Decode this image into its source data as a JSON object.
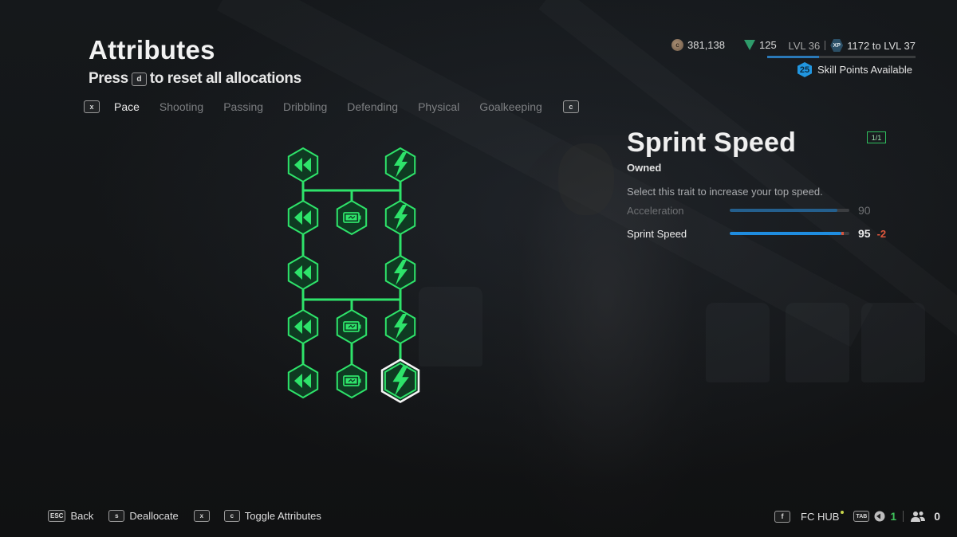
{
  "header": {
    "title": "Attributes",
    "subtitle_pre": "Press",
    "subtitle_key": "d",
    "subtitle_post": "to reset all allocations"
  },
  "tabs": {
    "prev_key": "x",
    "next_key": "c",
    "items": [
      {
        "label": "Pace",
        "active": true
      },
      {
        "label": "Shooting",
        "active": false
      },
      {
        "label": "Passing",
        "active": false
      },
      {
        "label": "Dribbling",
        "active": false
      },
      {
        "label": "Defending",
        "active": false
      },
      {
        "label": "Physical",
        "active": false
      },
      {
        "label": "Goalkeeping",
        "active": false
      }
    ]
  },
  "currency": {
    "coins": "381,138",
    "points": "125",
    "level": "LVL 36",
    "xp_icon_label": "XP",
    "xp_to_next": "1172 to LVL 37",
    "xp_progress_percent": 35,
    "skill_points": "25",
    "skill_points_label": "Skill Points Available"
  },
  "tree": {
    "accent": "#2ee36a",
    "nodes": [
      {
        "id": "l1",
        "col": "left",
        "row": 1,
        "icon": "rewind-icon"
      },
      {
        "id": "l2",
        "col": "left",
        "row": 2,
        "icon": "rewind-icon"
      },
      {
        "id": "l3",
        "col": "left",
        "row": 3,
        "icon": "rewind-icon"
      },
      {
        "id": "l4",
        "col": "left",
        "row": 4,
        "icon": "rewind-icon"
      },
      {
        "id": "l5",
        "col": "left",
        "row": 5,
        "icon": "rewind-icon"
      },
      {
        "id": "m2",
        "col": "mid",
        "row": 2,
        "icon": "battery-icon"
      },
      {
        "id": "m4",
        "col": "mid",
        "row": 4,
        "icon": "battery-icon"
      },
      {
        "id": "m5",
        "col": "mid",
        "row": 5,
        "icon": "battery-icon"
      },
      {
        "id": "r1",
        "col": "right",
        "row": 1,
        "icon": "lightning-icon"
      },
      {
        "id": "r2",
        "col": "right",
        "row": 2,
        "icon": "lightning-icon"
      },
      {
        "id": "r3",
        "col": "right",
        "row": 3,
        "icon": "lightning-icon"
      },
      {
        "id": "r4",
        "col": "right",
        "row": 4,
        "icon": "lightning-icon"
      },
      {
        "id": "r5",
        "col": "right",
        "row": 5,
        "icon": "lightning-icon",
        "selected": true
      }
    ]
  },
  "detail": {
    "title": "Sprint Speed",
    "rank": "1/1",
    "status": "Owned",
    "description": "Select this trait to increase your top speed.",
    "stats": [
      {
        "label": "Acceleration",
        "value": "90",
        "fill_percent": 90,
        "delta": "",
        "highlighted": false
      },
      {
        "label": "Sprint Speed",
        "value": "95",
        "fill_percent": 95,
        "delta": "-2",
        "delta_percent": 2,
        "highlighted": true
      }
    ]
  },
  "footer": {
    "left": [
      {
        "keys": [
          "ESC"
        ],
        "label": "Back"
      },
      {
        "keys": [
          "s"
        ],
        "label": "Deallocate"
      },
      {
        "keys": [
          "x",
          "c"
        ],
        "label": "Toggle Attributes"
      }
    ],
    "hub_key": "f",
    "hub_label": "FC HUB",
    "tab_key": "TAB",
    "notifications": "1",
    "friends": "0"
  }
}
